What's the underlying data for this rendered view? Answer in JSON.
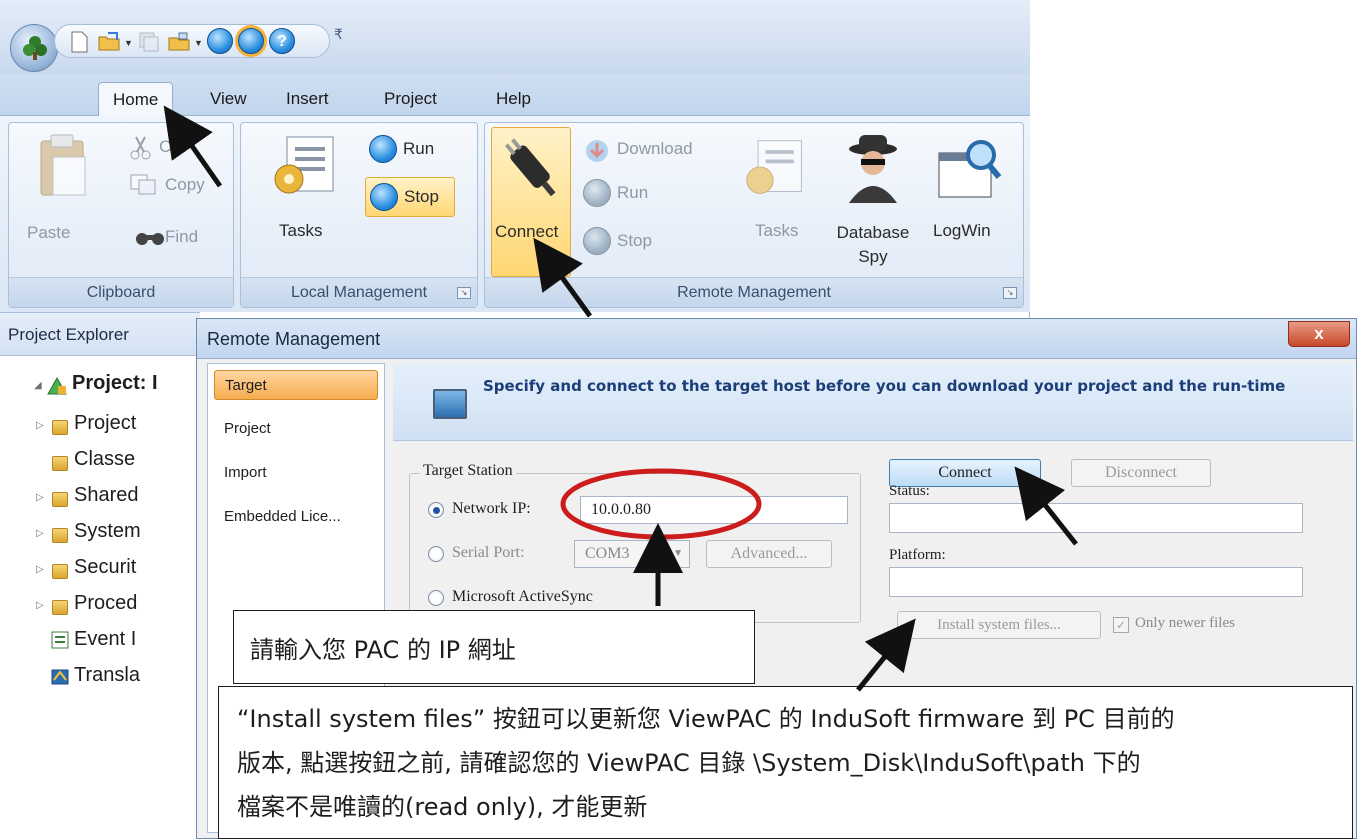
{
  "ribbon": {
    "tabs": [
      "Home",
      "View",
      "Insert",
      "Project",
      "Help"
    ],
    "active_tab": "Home",
    "clipboard": {
      "paste": "Paste",
      "cut": "Cut",
      "copy": "Copy",
      "find": "Find",
      "label": "Clipboard"
    },
    "local": {
      "tasks": "Tasks",
      "run": "Run",
      "stop": "Stop",
      "label": "Local Management"
    },
    "remote": {
      "connect": "Connect",
      "download": "Download",
      "run": "Run",
      "stop": "Stop",
      "tasks": "Tasks",
      "database_spy": "Database Spy",
      "logwin": "LogWin",
      "label": "Remote Management"
    }
  },
  "explorer": {
    "title": "Project Explorer",
    "items": [
      "Project: I",
      "Project",
      "Classe",
      "Shared",
      "System",
      "Securit",
      "Proced",
      "Event I",
      "Transla"
    ]
  },
  "dialog": {
    "title": "Remote Management",
    "close": "x",
    "nav": [
      "Target",
      "Project",
      "Import",
      "Embedded Lice..."
    ],
    "selected_nav": "Target",
    "header": "Specify and connect to the target host before you can download your project and the run-time",
    "station": {
      "legend": "Target Station",
      "network_ip_label": "Network IP:",
      "network_ip_value": "10.0.0.80",
      "serial_port_label": "Serial Port:",
      "serial_port_value": "COM3",
      "advanced": "Advanced...",
      "activesync": "Microsoft ActiveSync",
      "selected": "Network IP"
    },
    "connect": "Connect",
    "disconnect": "Disconnect",
    "status_label": "Status:",
    "status_value": "",
    "platform_label": "Platform:",
    "platform_value": "",
    "install_system_files": "Install system files...",
    "only_newer_files": "Only newer files",
    "only_newer_checked": true
  },
  "annotations": {
    "ip_hint": "請輸入您 PAC 的 IP 網址",
    "install_hint_lines": [
      "“Install system files” 按鈕可以更新您 ViewPAC 的 InduSoft firmware 到 PC 目前的",
      "版本, 點選按鈕之前, 請確認您的 ViewPAC 目錄 \\System_Disk\\InduSoft\\path 下的",
      "檔案不是唯讀的(read only), 才能更新"
    ]
  },
  "colors": {
    "accent": "#2a8fe0",
    "highlight": "#ffd773",
    "annotation_circle": "#cc1c1c"
  }
}
